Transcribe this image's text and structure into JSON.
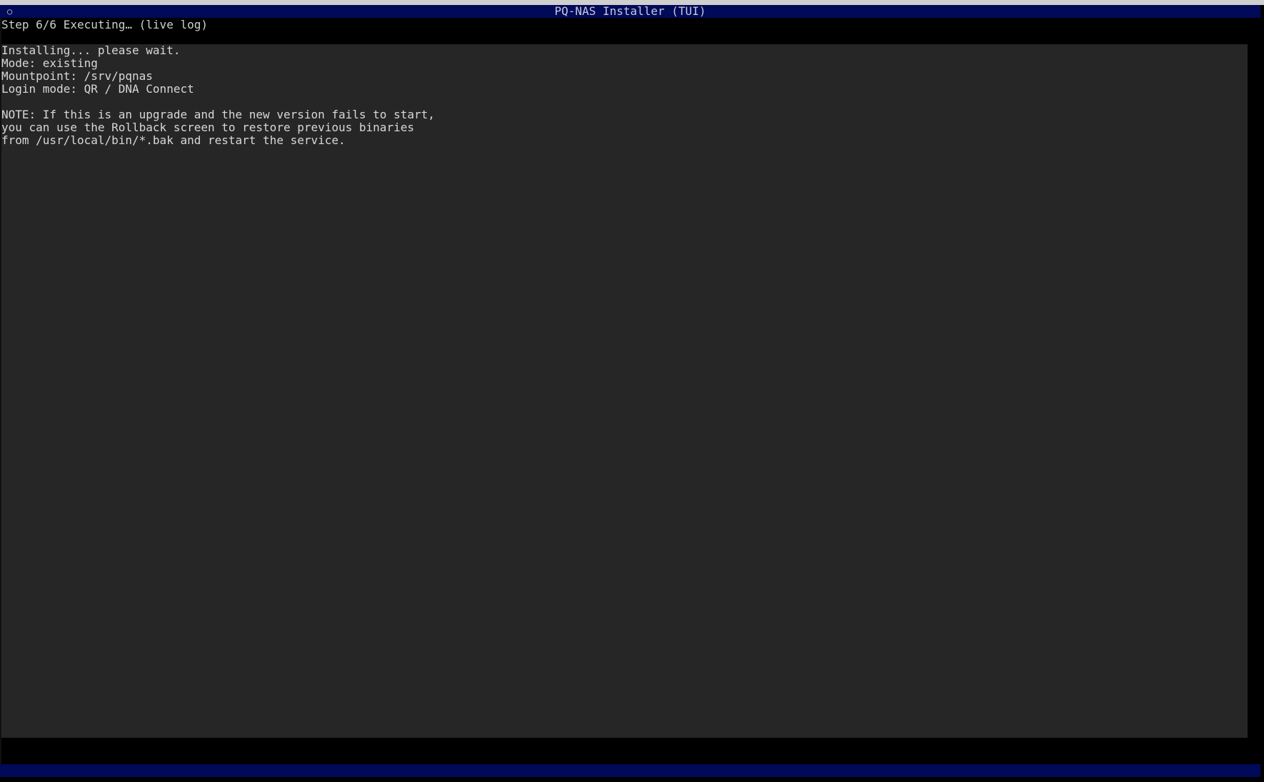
{
  "window": {
    "title": "PQ-NAS Installer (TUI)",
    "close_glyph": "○",
    "close_icon": "circle-icon"
  },
  "header": {
    "step_text": "Step 6/6 Executing… (live log)"
  },
  "log": {
    "lines": [
      "Installing... please wait.",
      "Mode: existing",
      "Mountpoint: /srv/pqnas",
      "Login mode: QR / DNA Connect",
      "",
      "NOTE: If this is an upgrade and the new version fails to start,",
      "you can use the Rollback screen to restore previous binaries",
      "from /usr/local/bin/*.bak and restart the service."
    ]
  },
  "colors": {
    "title_bar": "#000a58",
    "panel_bg": "#262626",
    "screen_bg": "#000000",
    "text": "#d8d8d8"
  }
}
